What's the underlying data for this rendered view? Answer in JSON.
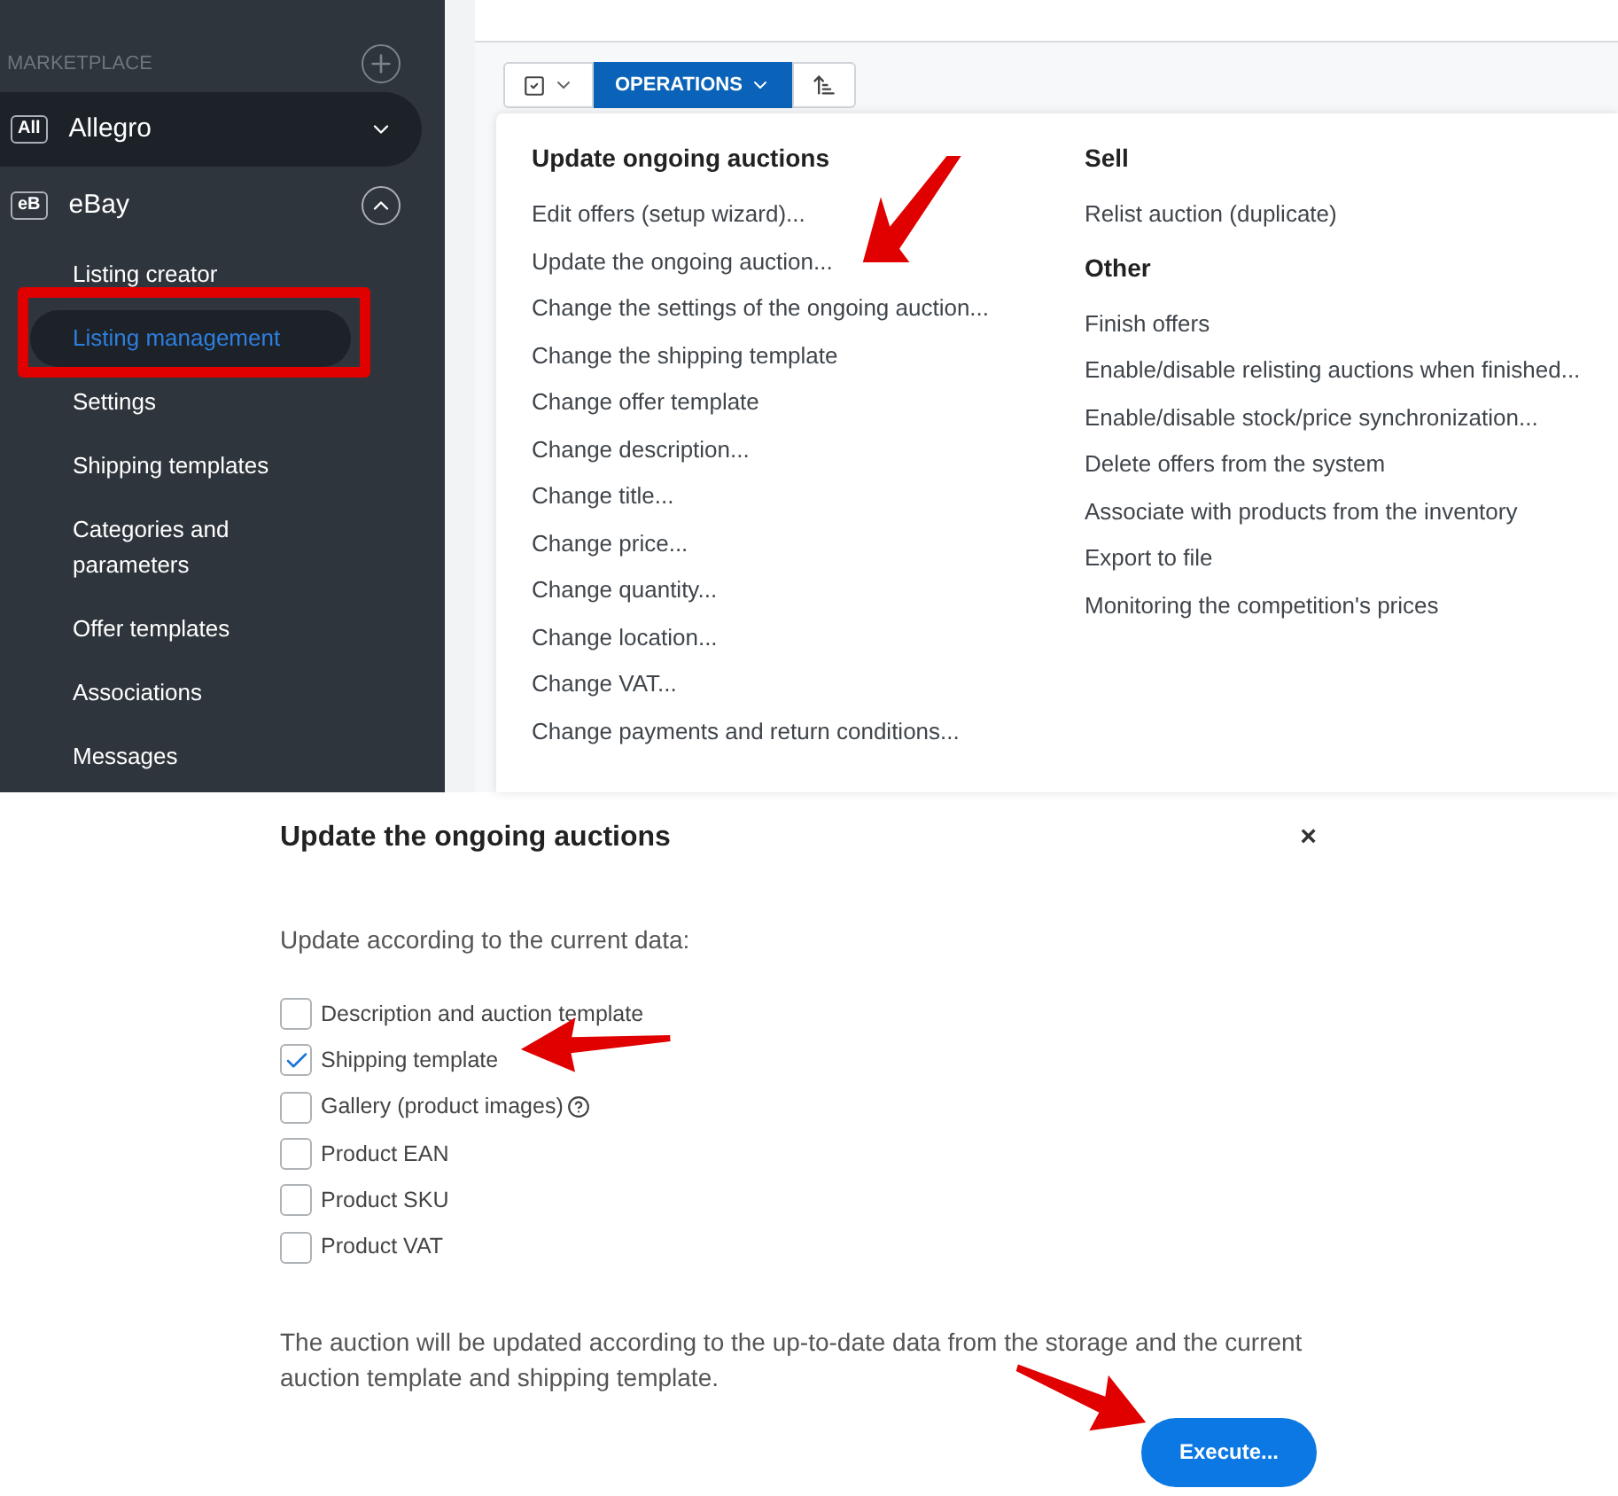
{
  "sidebar": {
    "section_label": "MARKETPLACE",
    "marketplaces": [
      {
        "badge": "All",
        "name": "Allegro",
        "expanded": false,
        "highlighted": true
      },
      {
        "badge": "eB",
        "name": "eBay",
        "expanded": true,
        "highlighted": false,
        "children": [
          {
            "label": "Listing creator",
            "selected": false
          },
          {
            "label": "Listing management",
            "selected": true
          },
          {
            "label": "Settings",
            "selected": false
          },
          {
            "label": "Shipping templates",
            "selected": false
          },
          {
            "label": "Categories and parameters",
            "selected": false
          },
          {
            "label": "Offer templates",
            "selected": false
          },
          {
            "label": "Associations",
            "selected": false
          },
          {
            "label": "Messages",
            "selected": false
          }
        ]
      }
    ]
  },
  "toolbar": {
    "operations_label": "OPERATIONS"
  },
  "operations_menu": {
    "columns": [
      {
        "sections": [
          {
            "heading": "Update ongoing auctions",
            "items": [
              "Edit offers (setup wizard)...",
              "Update the ongoing auction...",
              "Change the settings of the ongoing auction...",
              "Change the shipping template",
              "Change offer template",
              "Change description...",
              "Change title...",
              "Change price...",
              "Change quantity...",
              "Change location...",
              "Change VAT...",
              "Change payments and return conditions..."
            ]
          }
        ]
      },
      {
        "sections": [
          {
            "heading": "Sell",
            "items": [
              "Relist auction (duplicate)"
            ]
          },
          {
            "heading": "Other",
            "items": [
              "Finish offers",
              "Enable/disable relisting auctions when finished...",
              "Enable/disable stock/price synchronization...",
              "Delete offers from the system",
              "Associate with products from the inventory",
              "Export to file",
              "Monitoring the competition's prices"
            ]
          }
        ]
      }
    ]
  },
  "dialog": {
    "title": "Update the ongoing auctions",
    "close": "×",
    "prompt": "Update according to the current data:",
    "options": [
      {
        "label": "Description and auction template",
        "checked": false,
        "help": false
      },
      {
        "label": "Shipping template",
        "checked": true,
        "help": false
      },
      {
        "label": "Gallery (product images)",
        "checked": false,
        "help": true
      },
      {
        "label": "Product EAN",
        "checked": false,
        "help": false
      },
      {
        "label": "Product SKU",
        "checked": false,
        "help": false
      },
      {
        "label": "Product VAT",
        "checked": false,
        "help": false
      }
    ],
    "note": "The auction will be updated according to the up-to-date data from the storage and the current auction template and shipping template.",
    "button": "Execute..."
  }
}
